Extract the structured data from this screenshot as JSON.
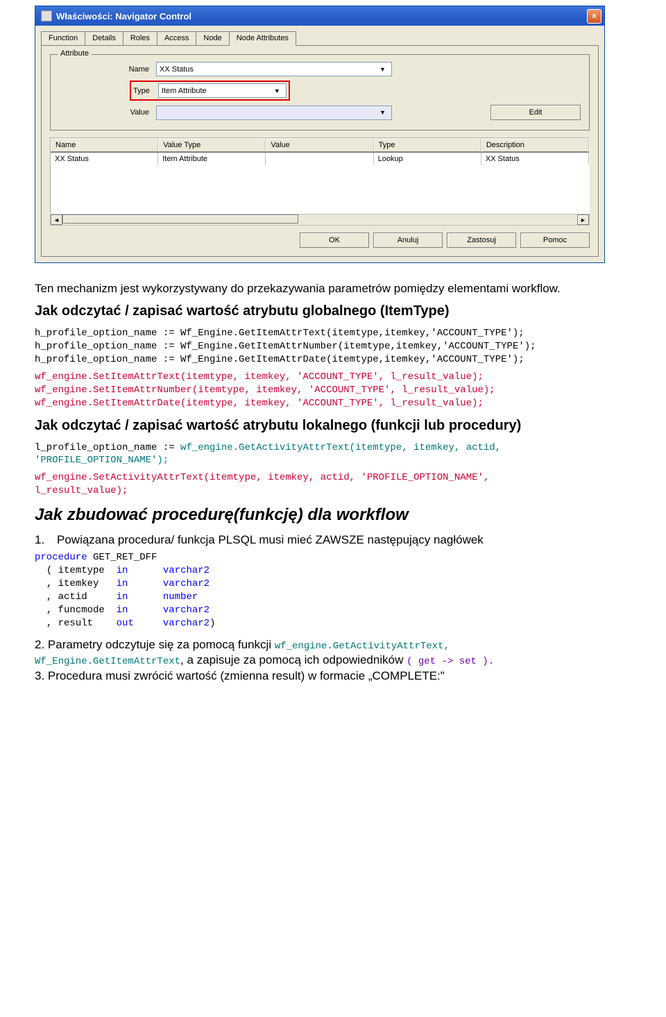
{
  "dialog": {
    "title": "Właściwości: Navigator Control",
    "close": "×",
    "tabs": [
      "Function",
      "Details",
      "Roles",
      "Access",
      "Node",
      "Node Attributes"
    ],
    "active_tab": 5,
    "fieldset_legend": "Attribute",
    "labels": {
      "name": "Name",
      "type": "Type",
      "value": "Value"
    },
    "fields": {
      "name": "XX Status",
      "type": "Item Attribute",
      "value": ""
    },
    "edit": "Edit",
    "columns": [
      "Name",
      "Value Type",
      "Value",
      "Type",
      "Description"
    ],
    "row": [
      "XX Status",
      "Item Attribute",
      "",
      "Lookup",
      "XX Status"
    ],
    "buttons": [
      "OK",
      "Anuluj",
      "Zastosuj",
      "Pomoc"
    ]
  },
  "doc": {
    "p1": "Ten mechanizm jest wykorzystywany do przekazywania parametrów pomiędzy elementami workflow.",
    "h1": "Jak odczytać / zapisać wartość atrybutu globalnego (ItemType)",
    "code1a": "h_profile_option_name := Wf_Engine.GetItemAttrText(itemtype,itemkey,'ACCOUNT_TYPE');\nh_profile_option_name := Wf_Engine.GetItemAttrNumber(itemtype,itemkey,'ACCOUNT_TYPE');\nh_profile_option_name := Wf_Engine.GetItemAttrDate(itemtype,itemkey,'ACCOUNT_TYPE');",
    "code1b": "wf_engine.SetItemAttrText(itemtype, itemkey, 'ACCOUNT_TYPE', l_result_value);\nwf_engine.SetItemAttrNumber(itemtype, itemkey, 'ACCOUNT_TYPE', l_result_value);\nwf_engine.SetItemAttrDate(itemtype, itemkey, 'ACCOUNT_TYPE', l_result_value);",
    "h2": "Jak odczytać / zapisać wartość atrybutu lokalnego (funkcji lub procedury)",
    "code2a_plain": "l_profile_option_name := ",
    "code2a_fn": "wf_engine.GetActivityAttrText(itemtype, itemkey, actid,\n'PROFILE_OPTION_NAME');",
    "code2b": "wf_engine.SetActivityAttrText(itemtype, itemkey, actid, 'PROFILE_OPTION_NAME',\nl_result_value);",
    "h3": "Jak zbudować procedurę(funkcję) dla workflow",
    "li1": "Powiązana procedura/ funkcja PLSQL musi mieć ZAWSZE następujący nagłówek",
    "proc_kw": "procedure",
    "proc_name": " GET_RET_DFF",
    "proc_params": [
      [
        "  ( itemtype  ",
        "in",
        "      ",
        "varchar2"
      ],
      [
        "  , itemkey   ",
        "in",
        "      ",
        "varchar2"
      ],
      [
        "  , actid     ",
        "in",
        "      ",
        "number"
      ],
      [
        "  , funcmode  ",
        "in",
        "      ",
        "varchar2"
      ],
      [
        "  , result    ",
        "out",
        "     ",
        "varchar2",
        ")"
      ]
    ],
    "li2a": "Parametry odczytuje się za pomocą funkcji ",
    "li2_fn1": "wf_engine.GetActivityAttrText,",
    "li2_fn2": "Wf_Engine.GetItemAttrText",
    "li2b": ", a zapisuje za pomocą ich odpowiedników ",
    "li2_paren": "( get -> set ).",
    "li3": "Procedura musi zwrócić wartość (zmienna result) w formacie „COMPLETE:\""
  }
}
